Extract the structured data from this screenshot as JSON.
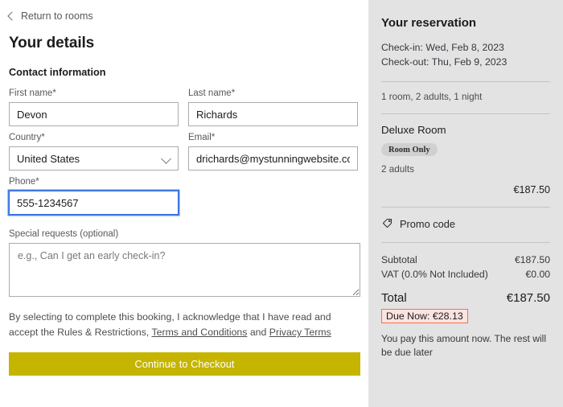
{
  "nav": {
    "return_label": "Return to rooms",
    "back_icon": "chevron-left-icon"
  },
  "main": {
    "page_title": "Your details",
    "section_title": "Contact information",
    "fields": {
      "first_name": {
        "label": "First name",
        "required_mark": "*",
        "value": "Devon"
      },
      "last_name": {
        "label": "Last name",
        "required_mark": "*",
        "value": "Richards"
      },
      "country": {
        "label": "Country",
        "required_mark": "*",
        "value": "United States",
        "chevron_icon": "chevron-down-icon"
      },
      "email": {
        "label": "Email",
        "required_mark": "*",
        "value": "drichards@mystunningwebsite.com"
      },
      "phone": {
        "label": "Phone",
        "required_mark": "*",
        "value": "555-1234567",
        "focused": true
      }
    },
    "special_requests": {
      "label": "Special requests (optional)",
      "placeholder": "e.g., Can I get an early check-in?",
      "value": ""
    },
    "terms": {
      "text_before": "By selecting to complete this booking, I acknowledge that I have read and accept the Rules & Restrictions, ",
      "link_terms": "Terms and Conditions",
      "text_middle": " and ",
      "link_privacy": "Privacy Terms"
    },
    "cta_label": "Continue to Checkout",
    "cta_color": "#C5B500"
  },
  "sidebar": {
    "title": "Your reservation",
    "check_in": "Check-in: Wed, Feb 8, 2023",
    "check_out": "Check-out: Thu, Feb 9, 2023",
    "summary": "1 room, 2 adults, 1 night",
    "room": {
      "name": "Deluxe Room",
      "badge": "Room Only",
      "guests": "2 adults",
      "price": "€187.50"
    },
    "promo": {
      "label": "Promo code",
      "icon": "tag-icon"
    },
    "totals": {
      "subtotal_label": "Subtotal",
      "subtotal_value": "€187.50",
      "vat_label": "VAT (0.0% Not Included)",
      "vat_value": "€0.00",
      "total_label": "Total",
      "total_value": "€187.50",
      "due_now": "Due Now: €28.13",
      "due_now_border_color": "#F4705A"
    },
    "note": "You pay this amount now. The rest will be due later",
    "background_color": "#E3E3E3"
  }
}
